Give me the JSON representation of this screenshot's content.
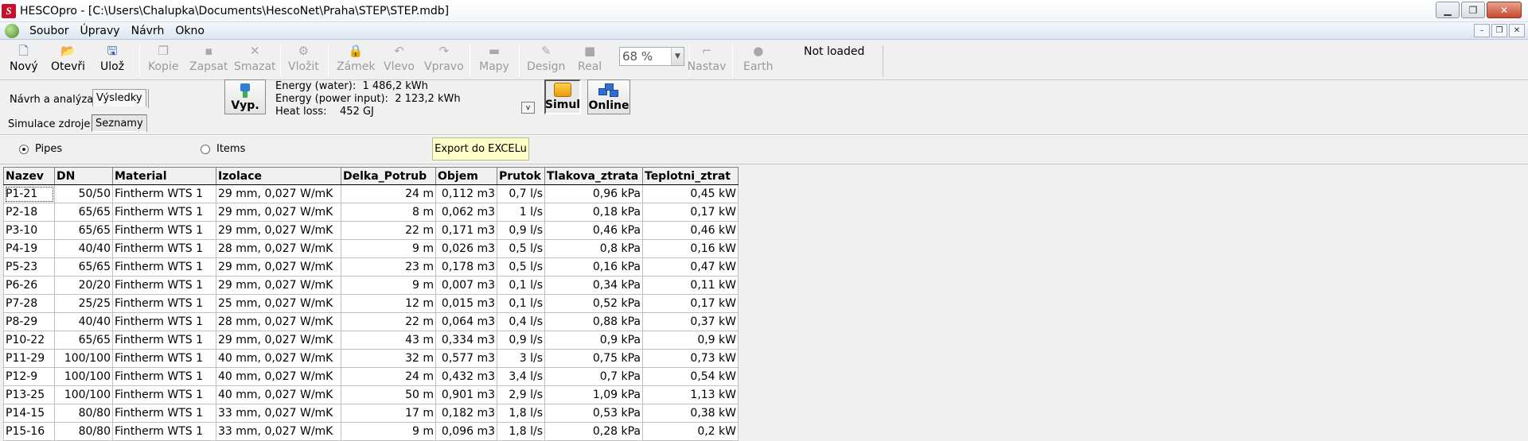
{
  "window": {
    "title": "HESCOpro - [C:\\Users\\Chalupka\\Documents\\HescoNet\\Praha\\STEP\\STEP.mdb]"
  },
  "menu": [
    "Soubor",
    "Úpravy",
    "Návrh",
    "Okno"
  ],
  "toolbar": {
    "novy": "Nový",
    "otevri": "Otevři",
    "uloz": "Ulož",
    "kopie": "Kopie",
    "zapsat": "Zapsat",
    "smazat": "Smazat",
    "vlozit": "Vložit",
    "zamek": "Zámek",
    "vlevo": "Vlevo",
    "vpravo": "Vpravo",
    "mapy": "Mapy",
    "design": "Design",
    "real": "Real",
    "zoom": "68 %",
    "nastav": "Nastav",
    "earth": "Earth",
    "status": "Not loaded"
  },
  "tabs": {
    "navrh": "Návrh a analýza",
    "vysledky": "Výsledky",
    "simulace": "Simulace zdroje",
    "seznamy": "Seznamy"
  },
  "calc": {
    "vyp_label": "Vyp.",
    "energy_water_label": "Energy (water):",
    "energy_water_value": "1 486,2 kWh",
    "energy_power_label": "Energy (power input):",
    "energy_power_value": "2 123,2 kWh",
    "heat_loss_label": "Heat loss:",
    "heat_loss_value": "452 GJ",
    "v_button": "v",
    "simul_label": "Simul",
    "online_label": "Online"
  },
  "view": {
    "pipes_label": "Pipes",
    "items_label": "Items",
    "selected": "Pipes",
    "export_label": "Export do EXCELu"
  },
  "table": {
    "columns": [
      "Nazev",
      "DN",
      "Material",
      "Izolace",
      "Delka_Potrub",
      "Objem",
      "Prutok",
      "Tlakova_ztrata",
      "Teplotni_ztrat"
    ],
    "rows": [
      [
        "P1-21",
        "50/50",
        "Fintherm WTS 1",
        "29 mm, 0,027 W/mK",
        "24 m",
        "0,112 m3",
        "0,7 l/s",
        "0,96 kPa",
        "0,45 kW"
      ],
      [
        "P2-18",
        "65/65",
        "Fintherm WTS 1",
        "29 mm, 0,027 W/mK",
        "8 m",
        "0,062 m3",
        "1 l/s",
        "0,18 kPa",
        "0,17 kW"
      ],
      [
        "P3-10",
        "65/65",
        "Fintherm WTS 1",
        "29 mm, 0,027 W/mK",
        "22 m",
        "0,171 m3",
        "0,9 l/s",
        "0,46 kPa",
        "0,46 kW"
      ],
      [
        "P4-19",
        "40/40",
        "Fintherm WTS 1",
        "28 mm, 0,027 W/mK",
        "9 m",
        "0,026 m3",
        "0,5 l/s",
        "0,8 kPa",
        "0,16 kW"
      ],
      [
        "P5-23",
        "65/65",
        "Fintherm WTS 1",
        "29 mm, 0,027 W/mK",
        "23 m",
        "0,178 m3",
        "0,5 l/s",
        "0,16 kPa",
        "0,47 kW"
      ],
      [
        "P6-26",
        "20/20",
        "Fintherm WTS 1",
        "29 mm, 0,027 W/mK",
        "9 m",
        "0,007 m3",
        "0,1 l/s",
        "0,34 kPa",
        "0,11 kW"
      ],
      [
        "P7-28",
        "25/25",
        "Fintherm WTS 1",
        "25 mm, 0,027 W/mK",
        "12 m",
        "0,015 m3",
        "0,1 l/s",
        "0,52 kPa",
        "0,17 kW"
      ],
      [
        "P8-29",
        "40/40",
        "Fintherm WTS 1",
        "28 mm, 0,027 W/mK",
        "22 m",
        "0,064 m3",
        "0,4 l/s",
        "0,88 kPa",
        "0,37 kW"
      ],
      [
        "P10-22",
        "65/65",
        "Fintherm WTS 1",
        "29 mm, 0,027 W/mK",
        "43 m",
        "0,334 m3",
        "0,9 l/s",
        "0,9 kPa",
        "0,9 kW"
      ],
      [
        "P11-29",
        "100/100",
        "Fintherm WTS 1",
        "40 mm, 0,027 W/mK",
        "32 m",
        "0,577 m3",
        "3 l/s",
        "0,75 kPa",
        "0,73 kW"
      ],
      [
        "P12-9",
        "100/100",
        "Fintherm WTS 1",
        "40 mm, 0,027 W/mK",
        "24 m",
        "0,432 m3",
        "3,4 l/s",
        "0,7 kPa",
        "0,54 kW"
      ],
      [
        "P13-25",
        "100/100",
        "Fintherm WTS 1",
        "40 mm, 0,027 W/mK",
        "50 m",
        "0,901 m3",
        "2,9 l/s",
        "1,09 kPa",
        "1,13 kW"
      ],
      [
        "P14-15",
        "80/80",
        "Fintherm WTS 1",
        "33 mm, 0,027 W/mK",
        "17 m",
        "0,182 m3",
        "1,8 l/s",
        "0,53 kPa",
        "0,38 kW"
      ],
      [
        "P15-16",
        "80/80",
        "Fintherm WTS 1",
        "33 mm, 0,027 W/mK",
        "9 m",
        "0,096 m3",
        "1,8 l/s",
        "0,28 kPa",
        "0,2 kW"
      ]
    ]
  }
}
